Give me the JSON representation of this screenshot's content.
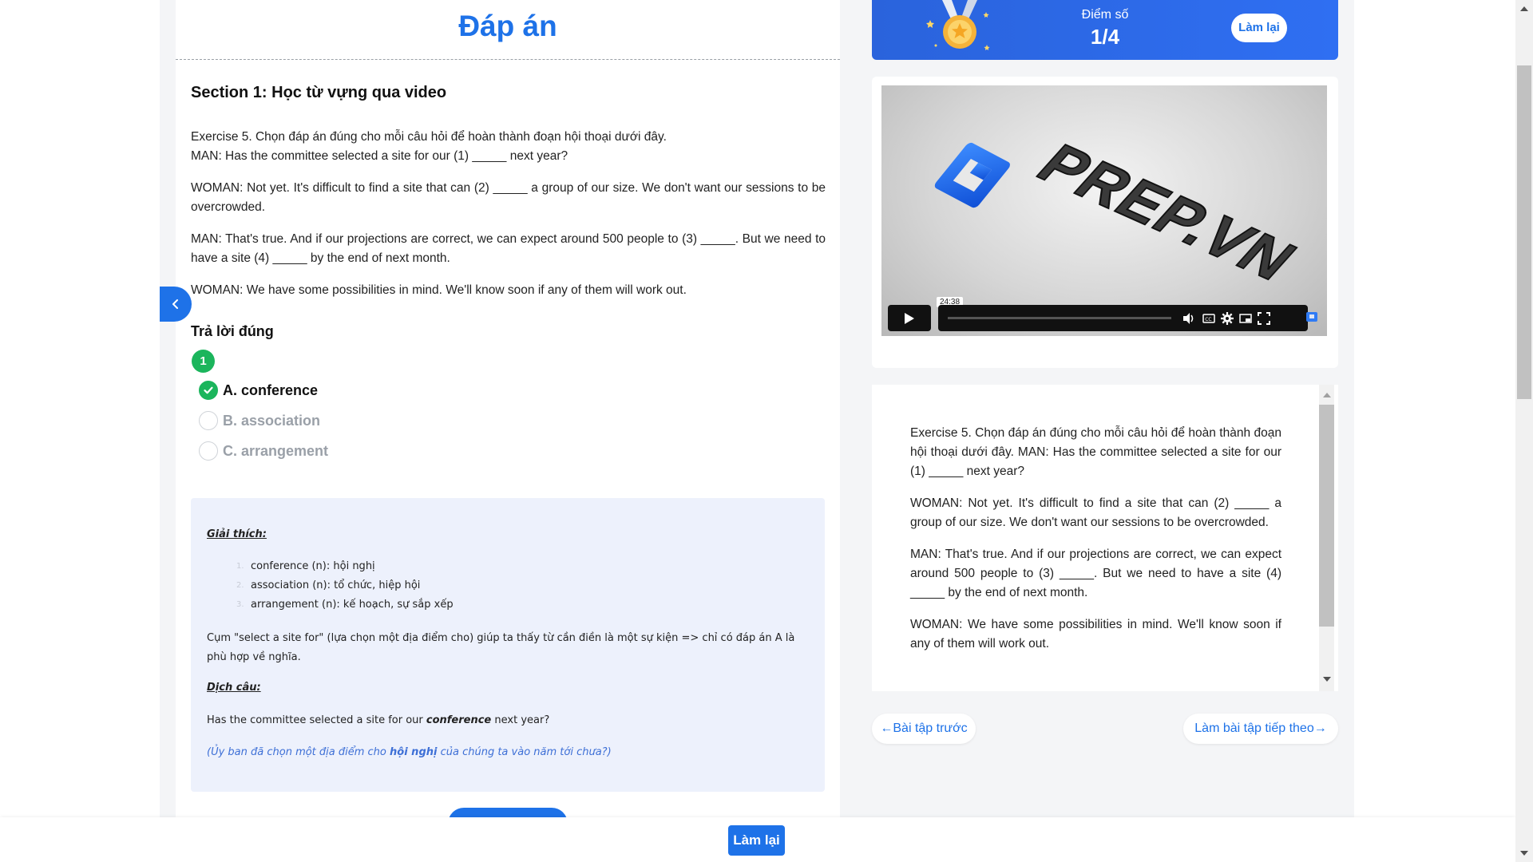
{
  "answer_title": "Đáp án",
  "section_title": "Section 1: Học từ vựng qua video",
  "passage": {
    "intro": "Exercise 5. Chọn đáp án đúng cho mỗi câu hỏi để hoàn thành đoạn hội thoại dưới đây.",
    "man1": "MAN: Has the committee selected a site for our (1) _____ next year?",
    "woman1": "WOMAN:  Not yet. It's difficult to find a site that can (2) _____ a group of our size. We don't want our sessions to be overcrowded.",
    "man2": "MAN: That's true. And if our projections are correct, we can expect around 500 people to (3) _____. But we need to have a site (4) _____ by the end of next month.",
    "woman2": "WOMAN: We have some possibilities in mind. We'll know soon if any of them will work out."
  },
  "correct_heading": "Trả lời đúng",
  "question_number": "1",
  "options": [
    {
      "label": "A. conference",
      "state": "correct"
    },
    {
      "label": "B. association",
      "state": "muted"
    },
    {
      "label": "C. arrangement",
      "state": "muted"
    }
  ],
  "explanation": {
    "heading": "Giải thích:",
    "items": [
      {
        "num": "1.",
        "text": "conference (n): hội nghị"
      },
      {
        "num": "2.",
        "text": "association (n): tổ chức, hiệp hội"
      },
      {
        "num": "3.",
        "text": "arrangement (n): kế hoạch, sự sắp xếp"
      }
    ],
    "paragraph": "Cụm \"select a site for\" (lựa chọn một địa điểm cho) giúp ta thấy từ cần điền là một sự kiện => chỉ có đáp án A là phù hợp về nghĩa.",
    "translation_heading": "Dịch câu:",
    "sentence_before": "Has the committee selected a site for our ",
    "sentence_key": "conference",
    "sentence_after": " next year?",
    "translation_before": "(Ủy ban đã chọn một địa điểm cho ",
    "translation_key": "hội nghị",
    "translation_after": " của chúng ta vào năm tới chưa?)"
  },
  "score": {
    "label": "Điểm số",
    "value": "1/4",
    "retry_label": "Làm lại"
  },
  "video": {
    "logo_text": "PREP.VN",
    "time": "24:38",
    "progress": 0.0
  },
  "nav": {
    "prev_label": "←Bài tập trước",
    "next_label": "Làm bài tập tiếp theo→"
  },
  "bottom": {
    "retry_label": "Làm lại"
  },
  "colors": {
    "primary": "#1e72e8",
    "correct": "#1bb55c",
    "explain_bg": "#edf1fc"
  }
}
